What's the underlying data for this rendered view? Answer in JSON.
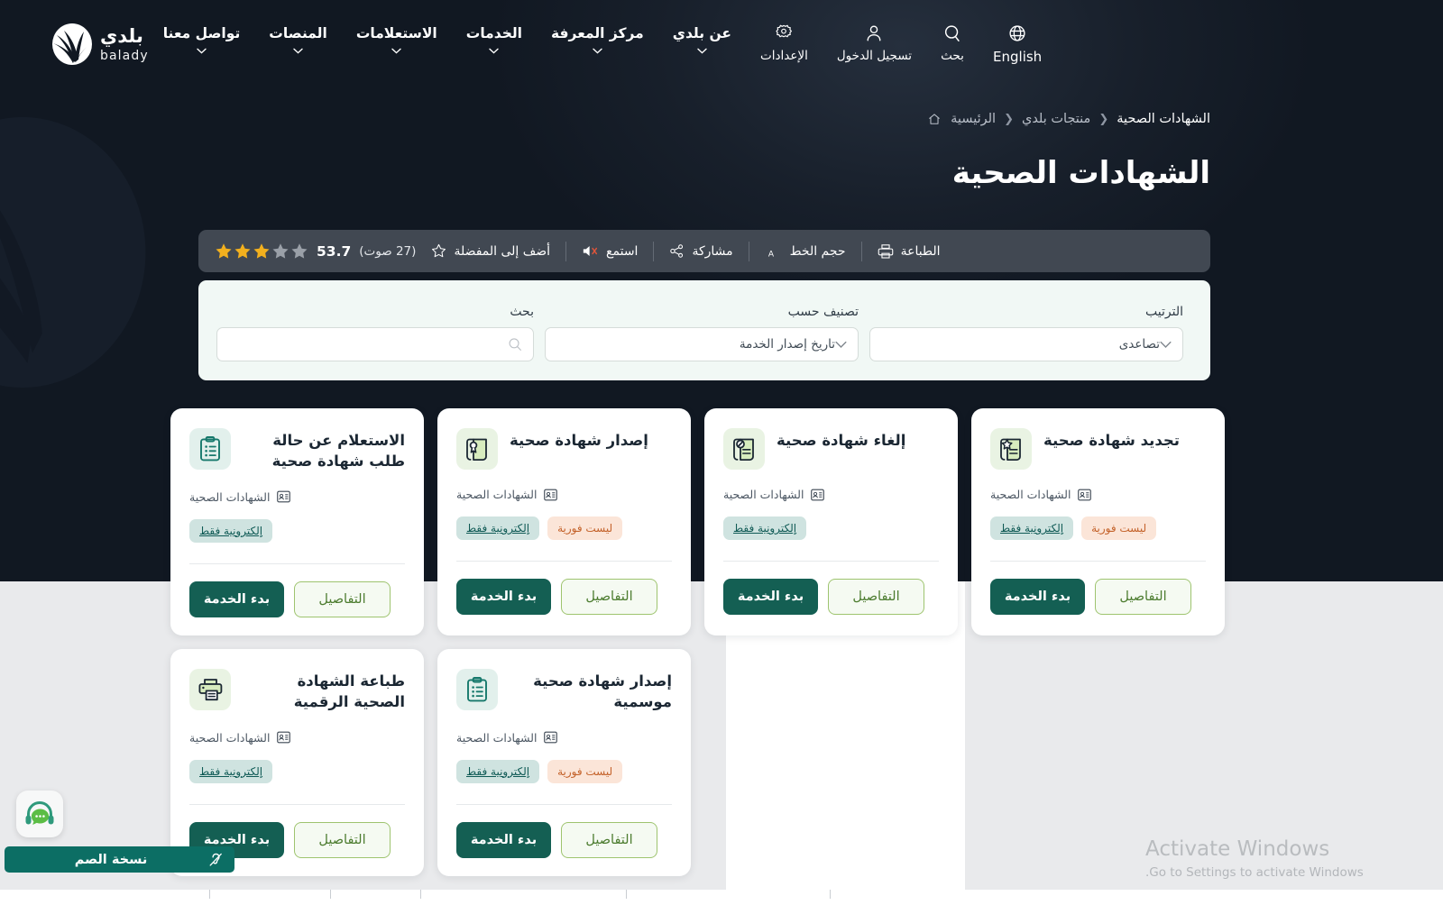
{
  "brand": {
    "ar": "بلدي",
    "en": "balady"
  },
  "nav": {
    "links": [
      {
        "label": "عن بلدي",
        "caret": true
      },
      {
        "label": "مركز المعرفة",
        "caret": true
      },
      {
        "label": "الخدمات",
        "caret": true
      },
      {
        "label": "الاستعلامات",
        "caret": true
      },
      {
        "label": "المنصات",
        "caret": true
      },
      {
        "label": "تواصل معنا",
        "caret": true
      }
    ],
    "tools": [
      {
        "label": "الإعدادات",
        "icon": "gear-icon"
      },
      {
        "label": "تسجيل الدخول",
        "icon": "user-icon"
      },
      {
        "label": "بحث",
        "icon": "search-icon"
      },
      {
        "label": "English",
        "icon": "globe-icon"
      }
    ]
  },
  "breadcrumb": {
    "home_icon": "home-icon",
    "items": [
      {
        "label": "الرئيسية",
        "current": false
      },
      {
        "label": "منتجات بلدي",
        "current": false
      },
      {
        "label": "الشهادات الصحية",
        "current": true
      }
    ],
    "separator": "❮"
  },
  "page": {
    "title": "الشهادات الصحية"
  },
  "toolbar": {
    "rating": {
      "value": "53.7",
      "votes": "(27 صوت)",
      "stars_total": 5,
      "stars_filled": 3,
      "star_color": "#f2b01e",
      "star_empty_color": "#9aa0a8"
    },
    "actions": [
      {
        "label": "أضف إلى المفضلة",
        "icon": "star-outline-icon"
      },
      {
        "label": "استمع",
        "icon": "speaker-mute-icon"
      },
      {
        "label": "مشاركة",
        "icon": "share-icon"
      },
      {
        "label": "حجم الخط",
        "icon": "font-size-icon"
      },
      {
        "label": "الطباعة",
        "icon": "printer-icon"
      }
    ]
  },
  "filters": {
    "search": {
      "label": "بحث",
      "value": "",
      "placeholder": "",
      "icon": "search-icon"
    },
    "sort_by": {
      "label": "تصنيف حسب",
      "value": "تاريخ إصدار الخدمة"
    },
    "order": {
      "label": "الترتيب",
      "value": "تصاعدى"
    }
  },
  "cards": [
    {
      "title": "الاستعلام عن حالة طلب شهادة صحية",
      "icon": "clipboard-list-icon",
      "icon_theme": "teal",
      "category": "الشهادات الصحية",
      "category_icon": "id-card-icon",
      "badges": [
        {
          "text": "إلكترونية فقط",
          "type": "eonly"
        }
      ],
      "details_label": "التفاصيل",
      "start_label": "بدء الخدمة"
    },
    {
      "title": "إصدار شهادة صحية",
      "icon": "certificate-scroll-icon",
      "icon_theme": "mint",
      "category": "الشهادات الصحية",
      "category_icon": "id-card-icon",
      "badges": [
        {
          "text": "إلكترونية فقط",
          "type": "eonly"
        },
        {
          "text": "ليست فورية",
          "type": "notinstant"
        }
      ],
      "details_label": "التفاصيل",
      "start_label": "بدء الخدمة"
    },
    {
      "title": "إلغاء شهادة صحية",
      "icon": "certificate-cancel-icon",
      "icon_theme": "mint",
      "category": "الشهادات الصحية",
      "category_icon": "id-card-icon",
      "badges": [
        {
          "text": "إلكترونية فقط",
          "type": "eonly"
        }
      ],
      "details_label": "التفاصيل",
      "start_label": "بدء الخدمة"
    },
    {
      "title": "تجديد شهادة صحية",
      "icon": "certificate-renew-icon",
      "icon_theme": "mint",
      "category": "الشهادات الصحية",
      "category_icon": "id-card-icon",
      "badges": [
        {
          "text": "إلكترونية فقط",
          "type": "eonly"
        },
        {
          "text": "ليست فورية",
          "type": "notinstant"
        }
      ],
      "details_label": "التفاصيل",
      "start_label": "بدء الخدمة"
    },
    {
      "title": "طباعة الشهادة الصحية الرقمية",
      "icon": "printer-doc-icon",
      "icon_theme": "mint",
      "category": "الشهادات الصحية",
      "category_icon": "id-card-icon",
      "badges": [
        {
          "text": "إلكترونية فقط",
          "type": "eonly"
        }
      ],
      "details_label": "التفاصيل",
      "start_label": "بدء الخدمة"
    },
    {
      "title": "إصدار شهادة صحية موسمية",
      "icon": "clipboard-list-icon",
      "icon_theme": "teal",
      "category": "الشهادات الصحية",
      "category_icon": "id-card-icon",
      "badges": [
        {
          "text": "إلكترونية فقط",
          "type": "eonly"
        },
        {
          "text": "ليست فورية",
          "type": "notinstant"
        }
      ],
      "details_label": "التفاصيل",
      "start_label": "بدء الخدمة"
    }
  ],
  "accessibility": {
    "fab_icon": "headset-chat-icon",
    "bar_label": "نسخة الصم",
    "bar_icon": "ear-accessibility-icon"
  },
  "watermark": {
    "line1": "Activate Windows",
    "line2": "Go to Settings to activate Windows."
  },
  "colors": {
    "hero_bg": "#111822",
    "page_bg": "#e9eaec",
    "toolbar_bg": "#414852",
    "filter_bg": "#f1f8f5",
    "primary": "#145f53",
    "accent_green": "#9ec46f",
    "badge_teal_bg": "#cfe3e0",
    "badge_orange_bg": "#fbe5d8"
  }
}
